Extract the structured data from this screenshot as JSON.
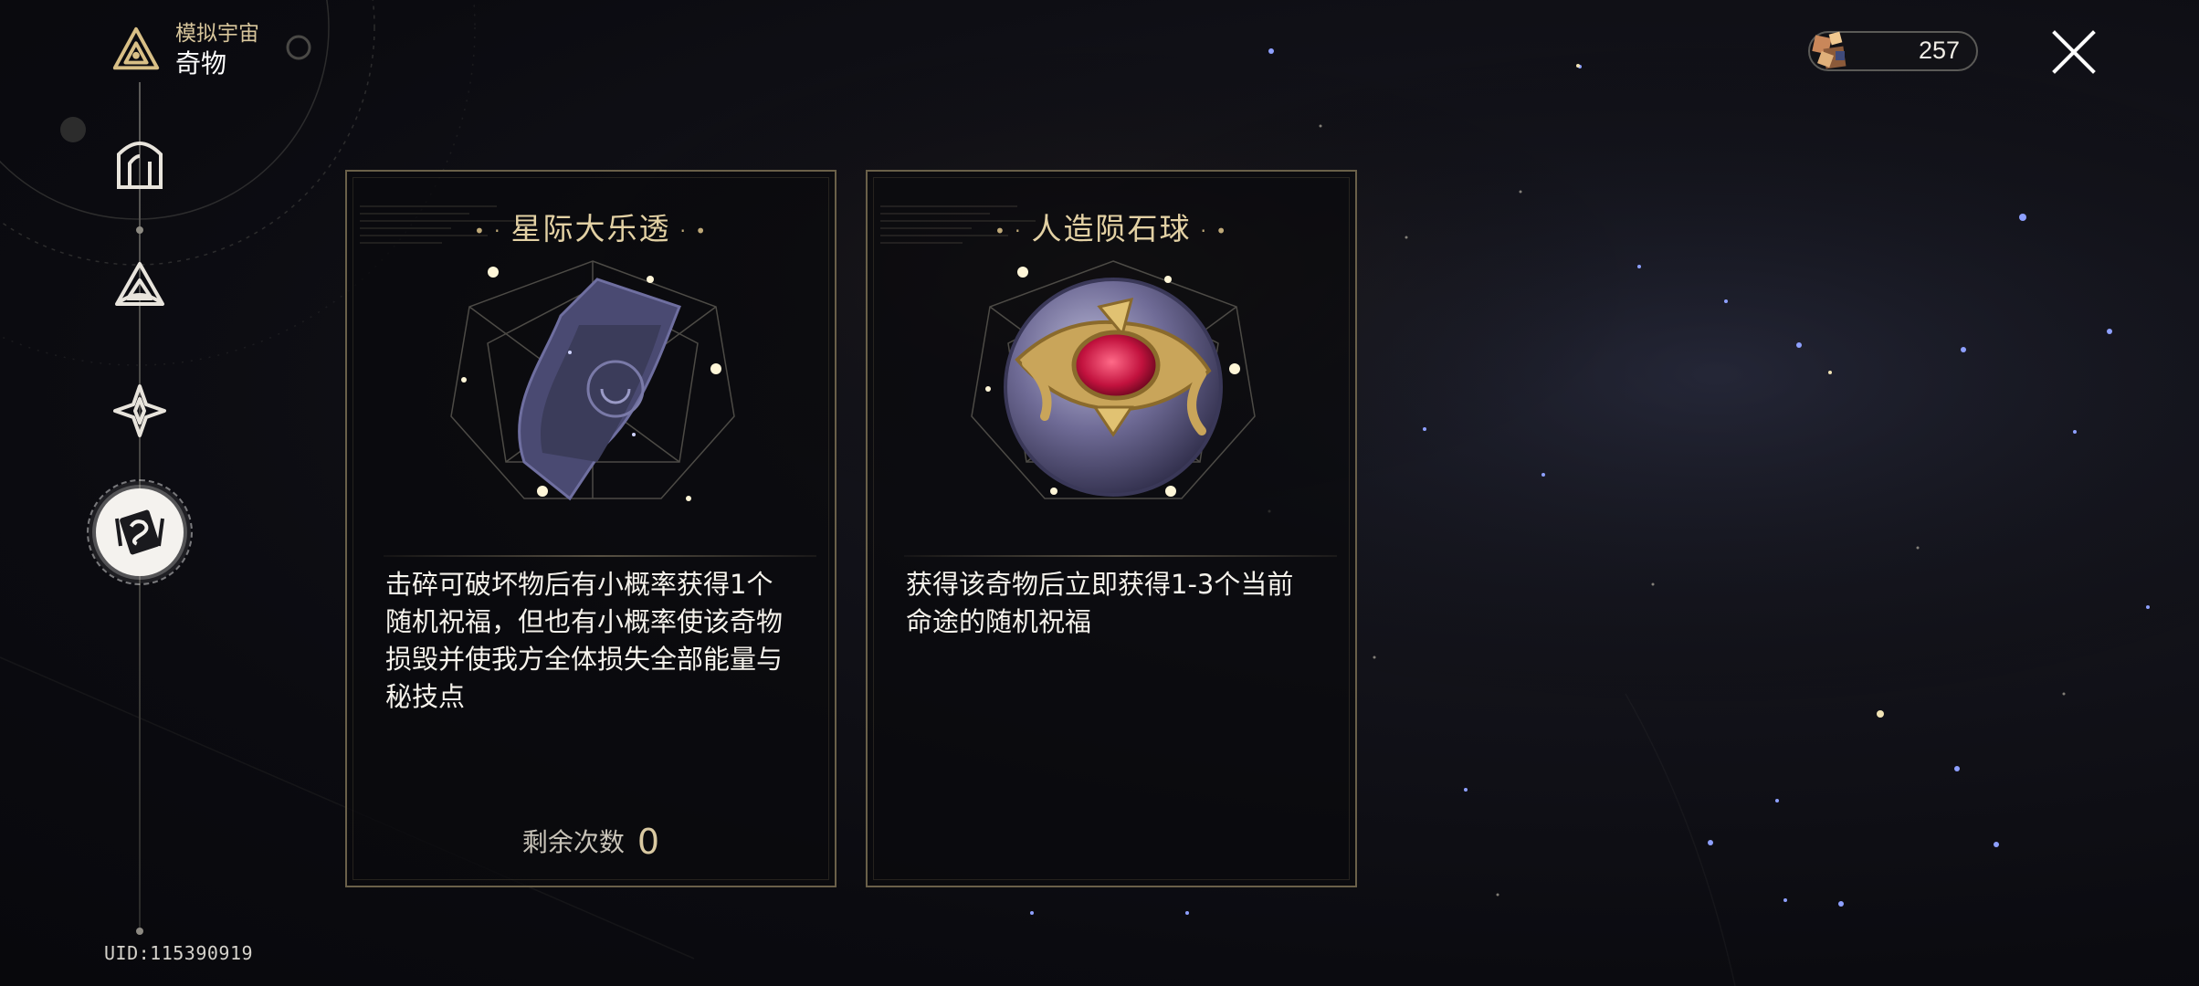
{
  "header": {
    "mode_label": "模拟宇宙",
    "page_title": "奇物"
  },
  "sidebar": {
    "items": [
      {
        "icon": "map-arch-icon",
        "active": false
      },
      {
        "icon": "triquetra-icon",
        "active": false
      },
      {
        "icon": "compass-star-icon",
        "active": false
      },
      {
        "icon": "curio-card-icon",
        "active": true
      }
    ]
  },
  "currency": {
    "icon": "cosmic-fragment-icon",
    "value": "257"
  },
  "close": {
    "icon": "close-icon"
  },
  "curios": [
    {
      "name": "星际大乐透",
      "icon": "lottery-ticket-icon",
      "description": "击碎可破坏物后有小概率获得1个随机祝福，但也有小概率使该奇物损毁并使我方全体损失全部能量与秘技点",
      "remaining_label": "剩余次数",
      "remaining_value": "0"
    },
    {
      "name": "人造陨石球",
      "icon": "meteor-orb-icon",
      "description": "获得该奇物后立即获得1-3个当前命途的随机祝福"
    }
  ],
  "uid": "UID:115390919",
  "colors": {
    "accent_gold": "#e3d1a4",
    "card_border": "#6a6049",
    "background": "#0b0b10"
  }
}
